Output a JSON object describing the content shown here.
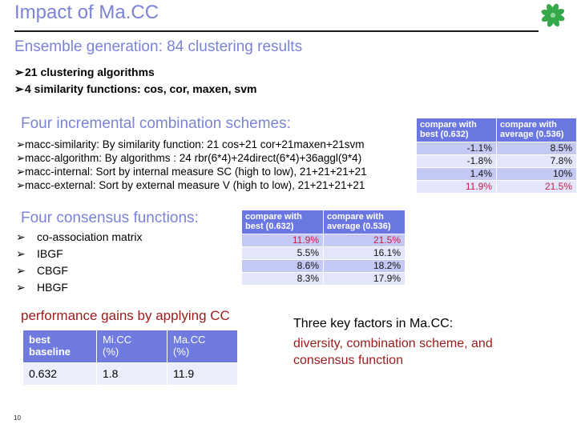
{
  "slide": {
    "title": "Impact of Ma.CC",
    "page_number": "10",
    "logo_icon": "green-pinwheel-flower-logo",
    "accent_color": "#7b83d6",
    "table_header_color": "#6b77e0",
    "highlight_color": "#c0204a",
    "red_text_color": "#9a1b1b"
  },
  "ensemble": {
    "heading": "Ensemble generation: 84 clustering results",
    "bullets": [
      "21 clustering algorithms",
      "4 similarity functions: cos, cor, maxen, svm"
    ],
    "bullet_glyph": "➢"
  },
  "schemes": {
    "heading": "Four incremental combination schemes:",
    "bullets": [
      "macc-similarity: By similarity function: 21 cos+21 cor+21maxen+21svm",
      "macc-algorithm: By algorithms : 24 rbr(6*4)+24direct(6*4)+36aggl(9*4)",
      "macc-internal: Sort by internal measure SC (high to low), 21+21+21+21",
      "macc-external: Sort by external measure V (high to low), 21+21+21+21"
    ],
    "bullet_glyph": "➢"
  },
  "consensus": {
    "heading": "Four consensus functions:",
    "bullets": [
      "co-association matrix",
      "IBGF",
      "CBGF",
      "HBGF"
    ],
    "bullet_glyph": "➢"
  },
  "chart_data": [
    {
      "type": "table",
      "name": "schemes-comparison-table",
      "columns": [
        "compare with best (0.632)",
        "compare with average (0.536)"
      ],
      "rows": [
        [
          "-1.1%",
          "8.5%"
        ],
        [
          "-1.8%",
          "7.8%"
        ],
        [
          "1.4%",
          "10%"
        ],
        [
          "11.9%",
          "21.5%"
        ]
      ],
      "highlighted_rows": [
        3
      ],
      "row_labels": [
        "macc-similarity",
        "macc-algorithm",
        "macc-internal",
        "macc-external"
      ]
    },
    {
      "type": "table",
      "name": "consensus-comparison-table",
      "columns": [
        "compare with best (0.632)",
        "compare with average (0.536)"
      ],
      "rows": [
        [
          "11.9%",
          "21.5%"
        ],
        [
          "5.5%",
          "16.1%"
        ],
        [
          "8.6%",
          "18.2%"
        ],
        [
          "8.3%",
          "17.9%"
        ]
      ],
      "highlighted_rows": [
        0
      ],
      "row_labels": [
        "co-association matrix",
        "IBGF",
        "CBGF",
        "HBGF"
      ]
    },
    {
      "type": "table",
      "name": "performance-gains-table",
      "columns": [
        "best baseline",
        "Mi.CC (%)",
        "Ma.CC (%)"
      ],
      "rows": [
        [
          "0.632",
          "1.8",
          "11.9"
        ]
      ]
    }
  ],
  "gains": {
    "caption": "performance gains by applying CC",
    "headers": {
      "col1_line1": "best",
      "col1_line2": "baseline",
      "col2_line1": "Mi.CC",
      "col2_line2": "(%)",
      "col3_line1": "Ma.CC",
      "col3_line2": "(%)"
    },
    "values": {
      "baseline": "0.632",
      "micc": "1.8",
      "macc": "11.9"
    }
  },
  "conclusion": {
    "line1": "Three key factors in Ma.CC:",
    "line2": "diversity, combination scheme, and",
    "line3": "consensus function"
  }
}
